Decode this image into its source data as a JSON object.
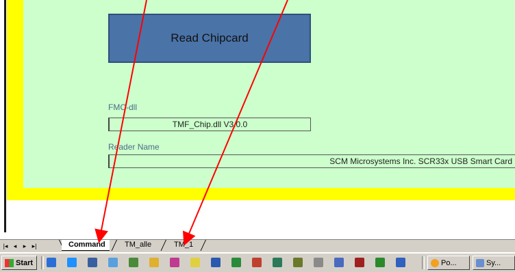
{
  "form": {
    "read_button": "Read Chipcard",
    "fmc_label": "FMC-dll",
    "fmc_value": "TMF_Chip.dll V3.0.0",
    "reader_label": "Reader Name",
    "reader_value": "SCM Microsystems Inc. SCR33x USB Smart Card"
  },
  "sheet_tabs": {
    "nav": [
      "|◂",
      "◂",
      "▸",
      "▸|"
    ],
    "tabs": [
      "Command",
      "TM_alle",
      "TM_1"
    ],
    "active": "Command"
  },
  "taskbar": {
    "start_label": "Start",
    "quick_launch_icons": [
      "outlook-express-icon",
      "ie-icon",
      "desktop-icon",
      "media-icon",
      "network-icon",
      "folder-icon",
      "paint-icon",
      "calc-icon",
      "word-icon",
      "excel-icon",
      "powerpoint-icon",
      "chart-icon",
      "tool-icon",
      "cabinet-icon",
      "notepad-icon",
      "card-reader-icon",
      "tree-icon",
      "media-player-icon"
    ],
    "tasks": [
      "Po...",
      "Sy..."
    ]
  },
  "colors": {
    "frame": "#ffff00",
    "panel": "#ccffcc",
    "button": "#4a73a8",
    "arrow": "#ff0000"
  }
}
